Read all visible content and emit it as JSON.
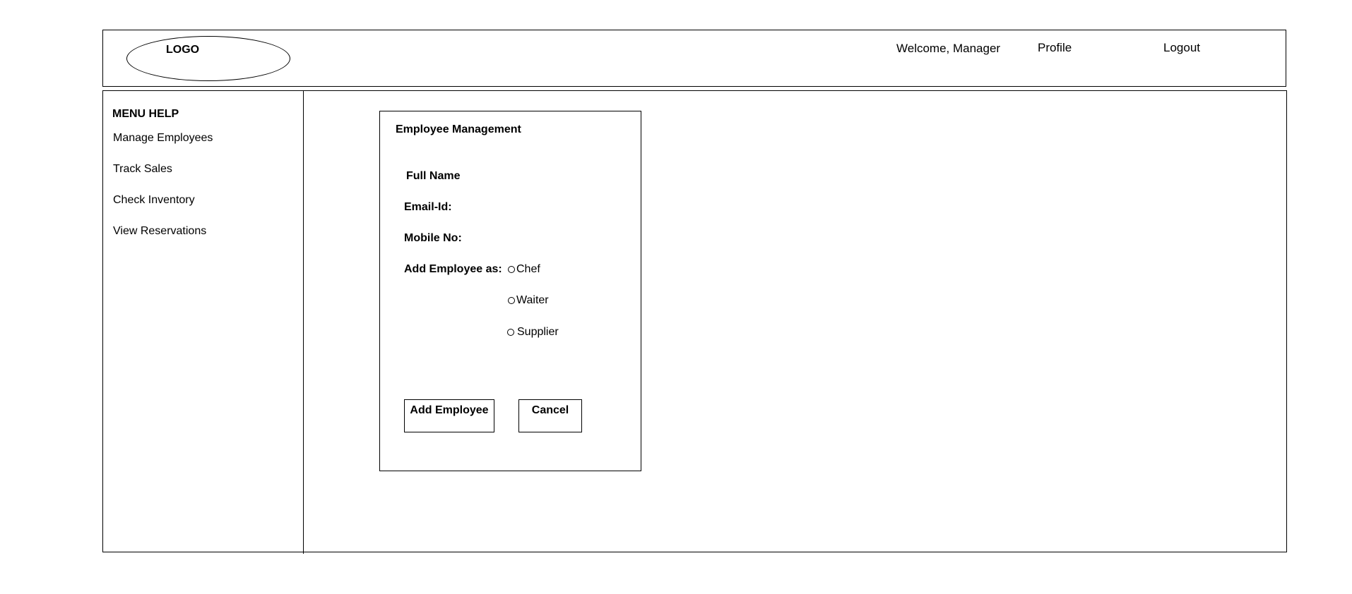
{
  "header": {
    "logo_text": "LOGO",
    "welcome_text": "Welcome, Manager",
    "profile_label": "Profile",
    "logout_label": "Logout"
  },
  "sidebar": {
    "title": "MENU HELP",
    "items": [
      {
        "label": "Manage Employees"
      },
      {
        "label": "Track Sales"
      },
      {
        "label": "Check Inventory"
      },
      {
        "label": "View Reservations"
      }
    ]
  },
  "form": {
    "title": "Employee Management",
    "full_name_label": "Full Name",
    "email_label": "Email-Id:",
    "mobile_label": "Mobile No:",
    "role_label": "Add Employee as:",
    "role_options": [
      {
        "label": "Chef"
      },
      {
        "label": "Waiter"
      },
      {
        "label": "Supplier"
      }
    ],
    "add_button_label": "Add Employee",
    "cancel_button_label": "Cancel"
  }
}
